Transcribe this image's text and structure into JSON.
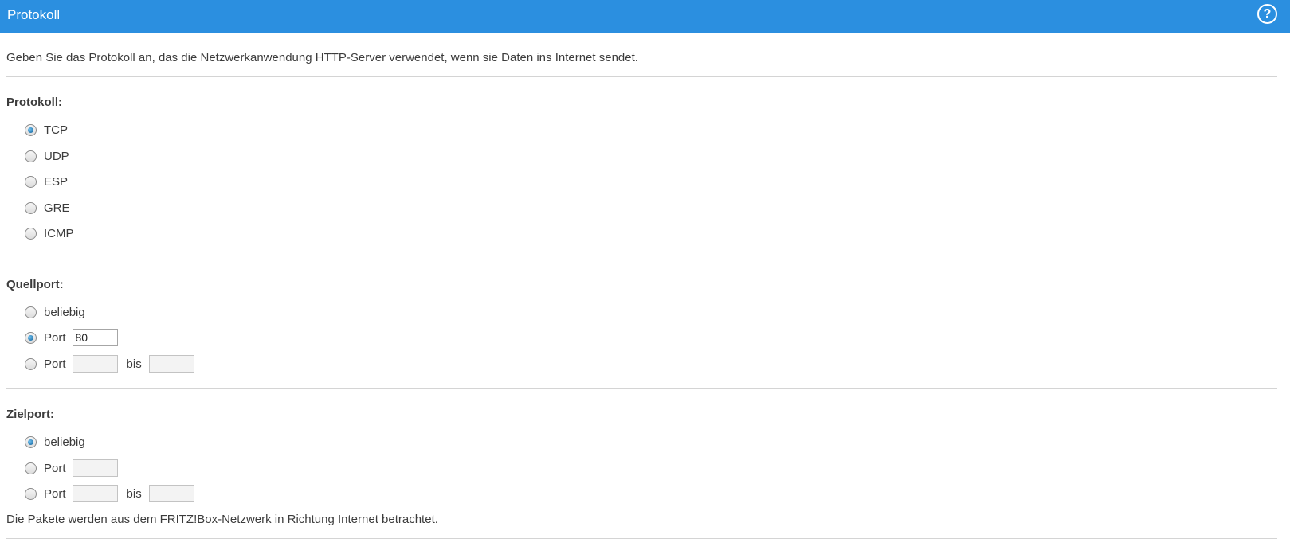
{
  "header": {
    "title": "Protokoll",
    "help_icon": "?"
  },
  "intro_text": "Geben Sie das Protokoll an, das die Netzwerkanwendung HTTP-Server verwendet, wenn sie Daten ins Internet sendet.",
  "protocol": {
    "label": "Protokoll:",
    "options": [
      "TCP",
      "UDP",
      "ESP",
      "GRE",
      "ICMP"
    ],
    "selected": "TCP"
  },
  "source_port": {
    "label": "Quellport:",
    "any_label": "beliebig",
    "port_label": "Port",
    "port_value": "80",
    "range_port_label": "Port",
    "range_from_value": "",
    "range_separator": "bis",
    "range_to_value": "",
    "selected": "port"
  },
  "dest_port": {
    "label": "Zielport:",
    "any_label": "beliebig",
    "port_label": "Port",
    "port_value": "",
    "range_port_label": "Port",
    "range_from_value": "",
    "range_separator": "bis",
    "range_to_value": "",
    "selected": "any"
  },
  "footer_note": "Die Pakete werden aus dem FRITZ!Box-Netzwerk in Richtung Internet betrachtet.",
  "colors": {
    "header_bg": "#2b8fe0",
    "radio_checked": "#0e5e96",
    "rule": "#d4d4d4"
  }
}
